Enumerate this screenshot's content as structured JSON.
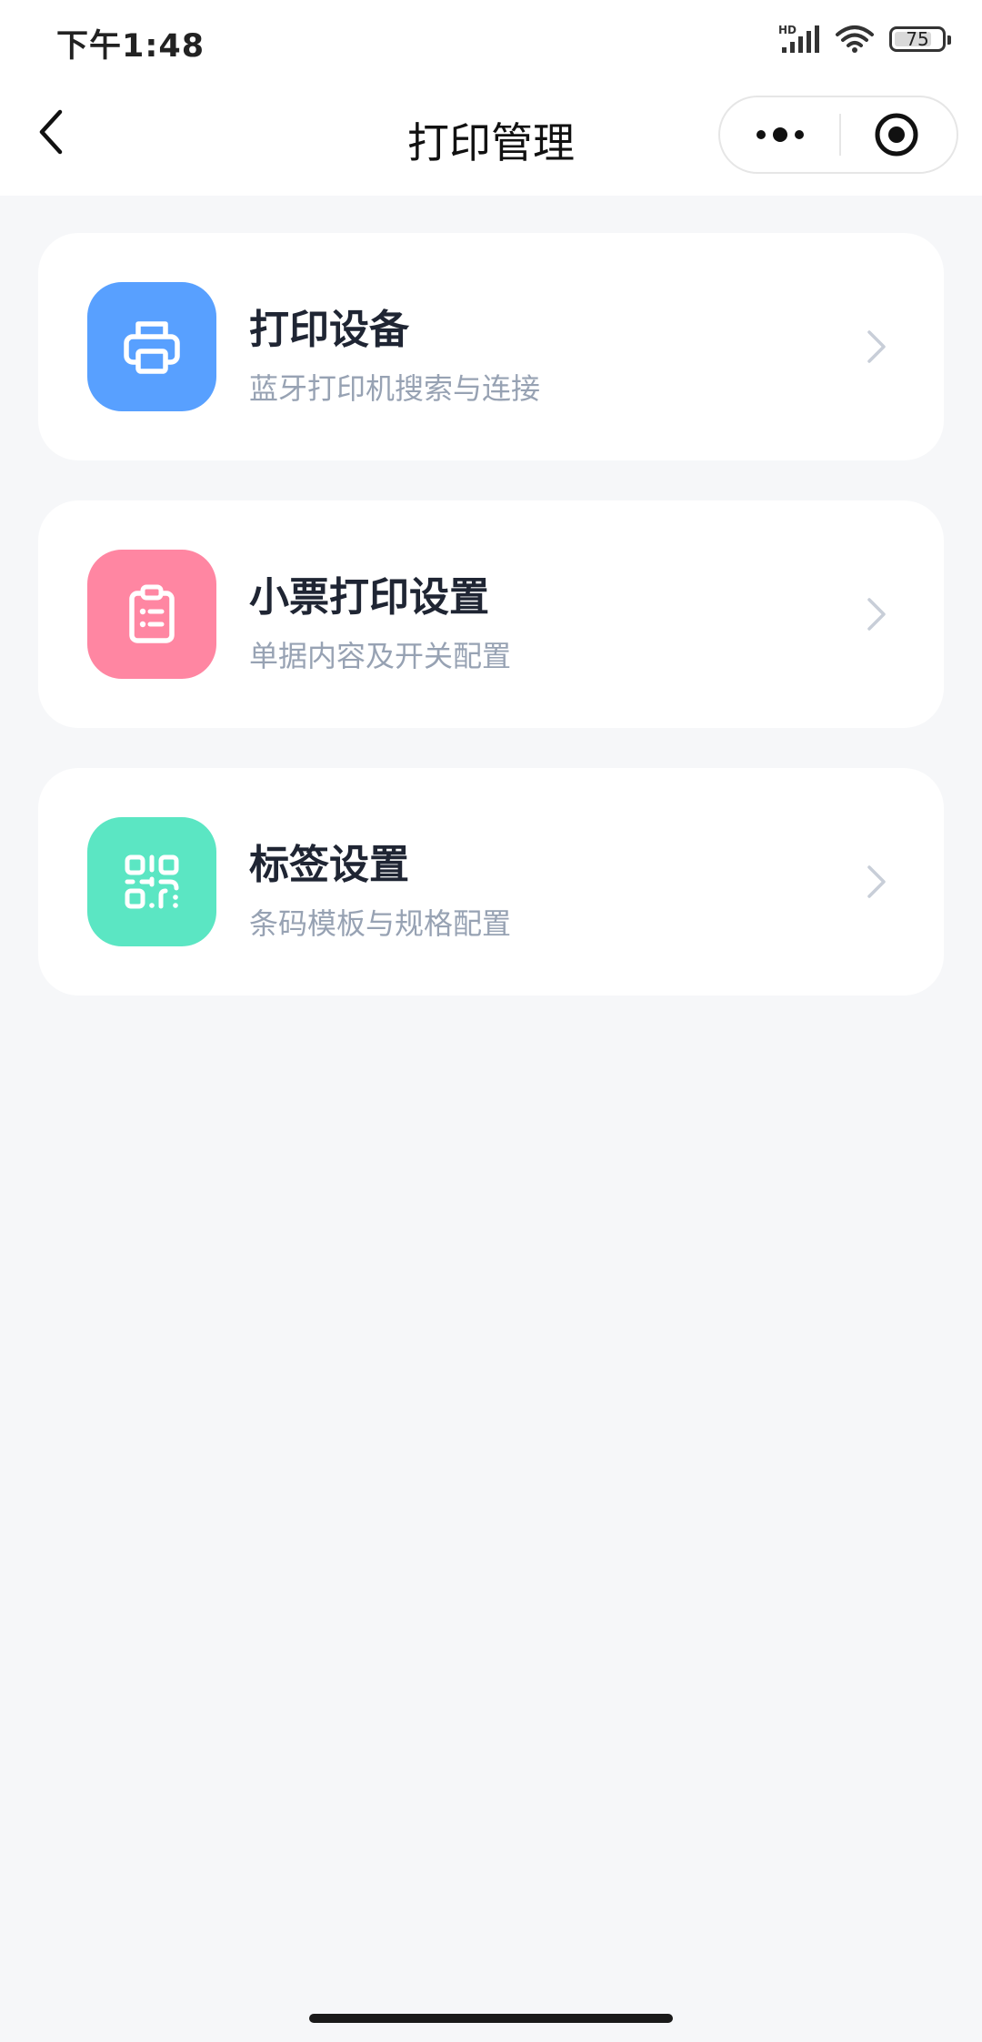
{
  "status_bar": {
    "time": "下午1:48",
    "network_label": "HD",
    "battery": "75",
    "icons": [
      "signal-icon",
      "wifi-icon",
      "battery-icon"
    ]
  },
  "nav": {
    "title": "打印管理",
    "back_icon": "chevron-left-icon",
    "more_icon": "more-dots-icon",
    "close_icon": "target-circle-icon"
  },
  "cards": [
    {
      "title": "打印设备",
      "subtitle": "蓝牙打印机搜索与连接",
      "icon": "printer-icon",
      "icon_bg": "#58a0ff"
    },
    {
      "title": "小票打印设置",
      "subtitle": "单据内容及开关配置",
      "icon": "clipboard-icon",
      "icon_bg": "#ff86a2"
    },
    {
      "title": "标签设置",
      "subtitle": "条码模板与规格配置",
      "icon": "qr-code-icon",
      "icon_bg": "#5be6c3"
    }
  ],
  "colors": {
    "background": "#f6f7f9",
    "card": "#ffffff",
    "title": "#1f2533",
    "subtitle": "#97a2b3",
    "chevron": "#c8ced8"
  }
}
